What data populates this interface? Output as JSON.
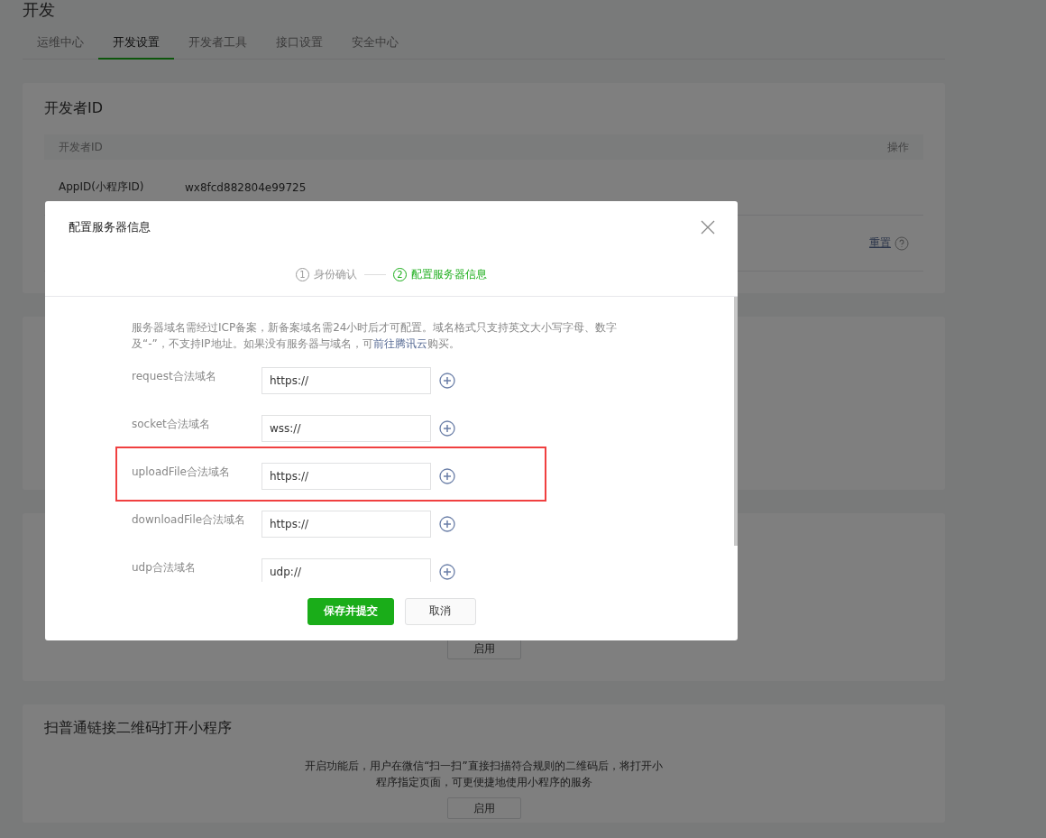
{
  "page": {
    "title": "开发",
    "tabs": [
      {
        "label": "运维中心",
        "selected": false
      },
      {
        "label": "开发设置",
        "selected": true
      },
      {
        "label": "开发者工具",
        "selected": false
      },
      {
        "label": "接口设置",
        "selected": false
      },
      {
        "label": "安全中心",
        "selected": false
      }
    ],
    "developer_id_card": {
      "title": "开发者ID",
      "columns": [
        "开发者ID",
        "操作"
      ],
      "app_id_label": "AppID(小程序ID)",
      "app_id_value": "wx8fcd882804e99725",
      "reset_link": "重置"
    },
    "hidden_card_button": "启用",
    "qr_card": {
      "title": "扫普通链接二维码打开小程序",
      "description": "开启功能后，用户在微信“扫一扫”直接扫描符合规则的二维码后，将打开小程序指定页面，可更便捷地使用小程序的服务",
      "button": "启用"
    }
  },
  "dialog": {
    "title": "配置服务器信息",
    "steps": [
      {
        "number": "1",
        "label": "身份确认",
        "selected": false
      },
      {
        "number": "2",
        "label": "配置服务器信息",
        "selected": true
      }
    ],
    "notice": {
      "before": "服务器域名需经过ICP备案，新备案域名需24小时后才可配置。域名格式只支持英文大小写字母、数字及“-”，不支持IP地址。如果没有服务器与域名，可",
      "link": "前往腾讯云",
      "after": "购买。"
    },
    "fields": [
      {
        "label": "request合法域名",
        "value": "https://",
        "highlighted": false
      },
      {
        "label": "socket合法域名",
        "value": "wss://",
        "highlighted": false
      },
      {
        "label": "uploadFile合法域名",
        "value": "https://",
        "highlighted": true
      },
      {
        "label": "downloadFile合法域名",
        "value": "https://",
        "highlighted": false
      },
      {
        "label": "udp合法域名",
        "value": "udp://",
        "highlighted": false
      }
    ],
    "buttons": [
      {
        "label": "保存并提交",
        "kind": "primary"
      },
      {
        "label": "取消",
        "kind": "default"
      }
    ]
  }
}
